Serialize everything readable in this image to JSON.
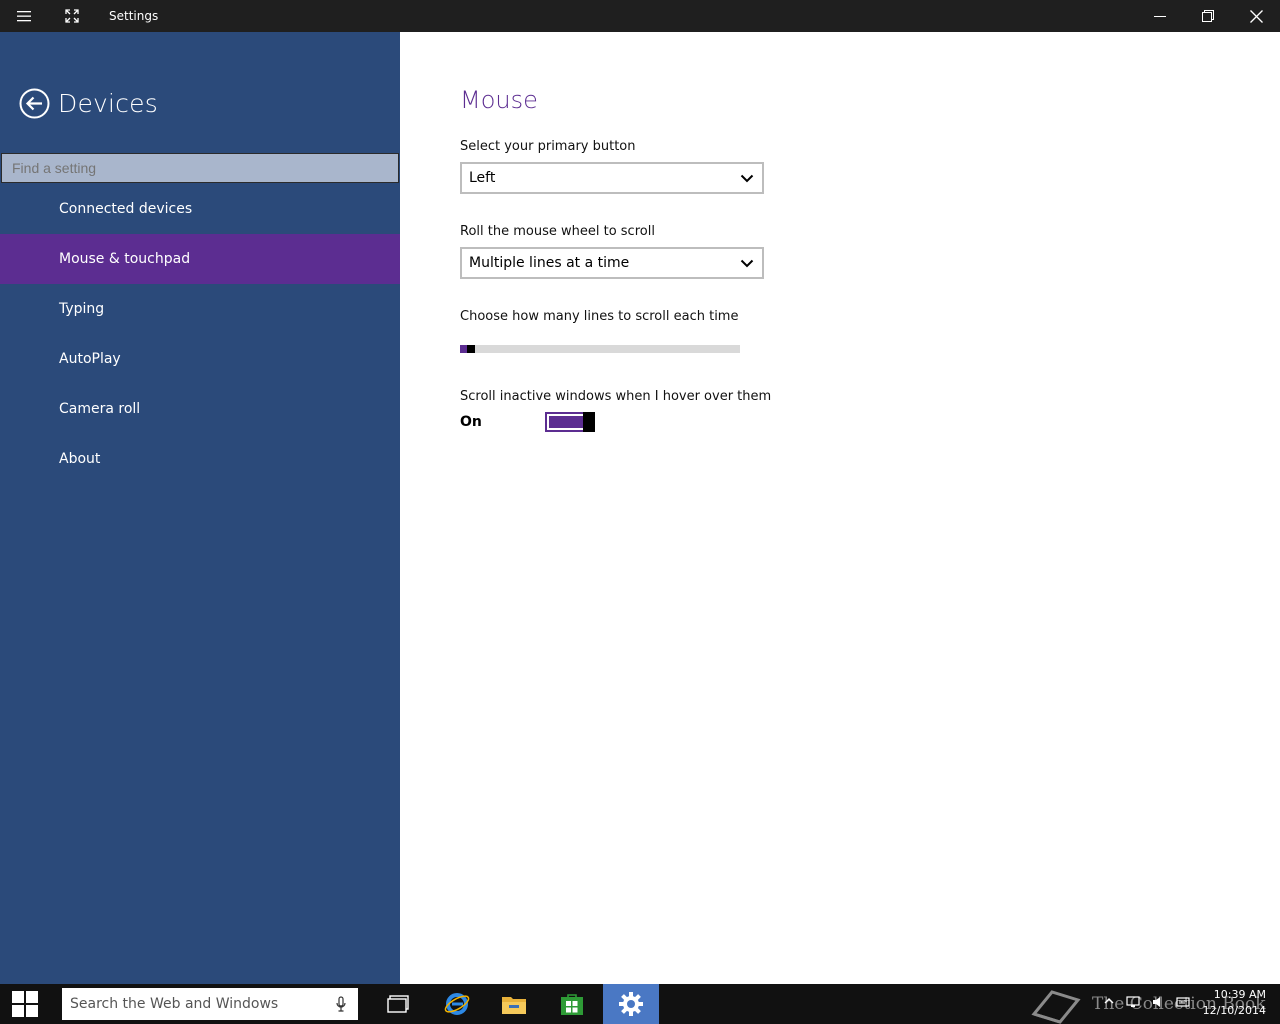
{
  "window": {
    "title": "Settings"
  },
  "sidebar": {
    "section_title": "Devices",
    "search_placeholder": "Find a setting",
    "items": [
      {
        "label": "Connected devices",
        "active": false
      },
      {
        "label": "Mouse & touchpad",
        "active": true
      },
      {
        "label": "Typing",
        "active": false
      },
      {
        "label": "AutoPlay",
        "active": false
      },
      {
        "label": "Camera roll",
        "active": false
      },
      {
        "label": "About",
        "active": false
      }
    ]
  },
  "main": {
    "title": "Mouse",
    "primary_button": {
      "label": "Select your primary button",
      "value": "Left"
    },
    "wheel_scroll": {
      "label": "Roll the mouse wheel to scroll",
      "value": "Multiple lines at a time"
    },
    "lines_slider": {
      "label": "Choose how many lines to scroll each time",
      "value_fraction": 0.035
    },
    "inactive_scroll": {
      "label": "Scroll inactive windows when I hover over them",
      "state": "On"
    }
  },
  "taskbar": {
    "search_placeholder": "Search the Web and Windows",
    "watermark": "The Collection Book",
    "time": "10:39 AM",
    "date": "12/10/2014"
  },
  "colors": {
    "accent": "#5c2d91",
    "sidebar": "#2b4a7a",
    "titlebar": "#1f1f1f",
    "taskbar": "#111111"
  }
}
